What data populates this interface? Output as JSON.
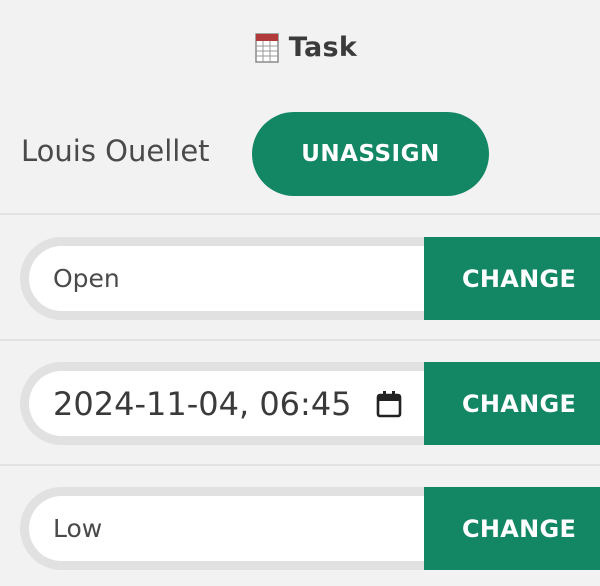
{
  "header": {
    "title": "Task",
    "icon": "task-sheet-icon"
  },
  "assignee": {
    "name": "Louis Ouellet",
    "unassign_label": "UNASSIGN"
  },
  "fields": {
    "status": {
      "value": "Open",
      "button_label": "CHANGE"
    },
    "due_date": {
      "value": "2024-11-04, 06:45",
      "icon": "calendar-icon",
      "button_label": "CHANGE"
    },
    "priority": {
      "value": "Low",
      "button_label": "CHANGE"
    }
  },
  "colors": {
    "accent": "#138663",
    "background": "#f2f2f2",
    "icon_red": "#b33a3a"
  }
}
